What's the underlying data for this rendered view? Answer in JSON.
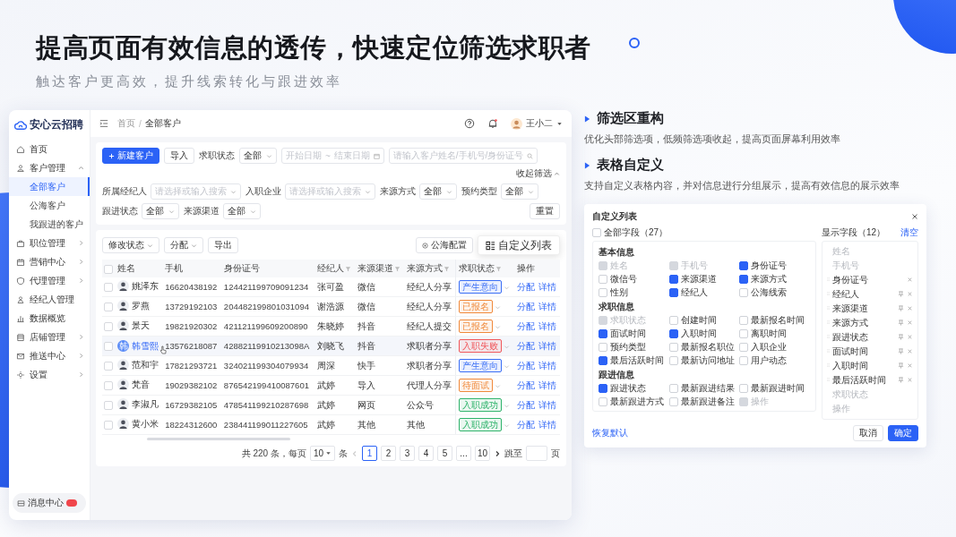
{
  "headline": "提高页面有效信息的透传，快速定位筛选求职者",
  "subheadline": "触达客户更高效，提升线索转化与跟进效率",
  "app": {
    "logo": "安心云招聘",
    "sidebar": {
      "items": [
        {
          "label": "首页",
          "has_children": false
        },
        {
          "label": "客户管理",
          "has_children": true,
          "expanded": true,
          "children": [
            {
              "label": "全部客户",
              "selected": true
            },
            {
              "label": "公海客户",
              "selected": false
            },
            {
              "label": "我跟进的客户",
              "selected": false
            }
          ]
        },
        {
          "label": "职位管理",
          "has_children": true,
          "expanded": false
        },
        {
          "label": "营销中心",
          "has_children": true,
          "expanded": false
        },
        {
          "label": "代理管理",
          "has_children": true,
          "expanded": false
        },
        {
          "label": "经纪人管理",
          "has_children": false
        },
        {
          "label": "数据概览",
          "has_children": false
        },
        {
          "label": "店铺管理",
          "has_children": true,
          "expanded": false
        },
        {
          "label": "推送中心",
          "has_children": true,
          "expanded": false
        },
        {
          "label": "设置",
          "has_children": true,
          "expanded": false
        }
      ],
      "message_center": "消息中心"
    },
    "header": {
      "breadcrumb": [
        "首页",
        "全部客户"
      ],
      "breadcrumb_separator": "/",
      "user": "王小二"
    },
    "filters": {
      "buttons": [
        {
          "label": "新建客户",
          "kind": "primary"
        },
        {
          "label": "导入",
          "kind": "default"
        }
      ],
      "row_1": [
        {
          "kind": "select",
          "label": "求职状态",
          "value": "全部"
        },
        {
          "kind": "date_range",
          "start_placeholder": "开始日期",
          "separator": "~",
          "end_placeholder": "结束日期"
        },
        {
          "kind": "search",
          "placeholder": "请输入客户姓名/手机号/身份证号"
        }
      ],
      "collapse": "收起筛选",
      "row_2": [
        {
          "kind": "select",
          "label": "所属经纪人",
          "placeholder": "请选择或输入搜索"
        },
        {
          "kind": "select",
          "label": "入职企业",
          "placeholder": "请选择或输入搜索"
        },
        {
          "kind": "select",
          "label": "来源方式",
          "value": "全部"
        },
        {
          "kind": "select",
          "label": "预约类型",
          "value": "全部"
        },
        {
          "kind": "select",
          "label": "跟进状态",
          "value": "全部"
        },
        {
          "kind": "select",
          "label": "来源渠道",
          "value": "全部"
        }
      ],
      "reset": "重置"
    },
    "toolbar": {
      "buttons": [
        {
          "label": "修改状态",
          "dropdown": true
        },
        {
          "label": "分配",
          "dropdown": true
        },
        {
          "label": "导出",
          "dropdown": false
        }
      ],
      "pool_config": "公海配置",
      "custom_columns": "自定义列表"
    },
    "table": {
      "select_all": {
        "checked": false
      },
      "columns": [
        {
          "label": "姓名",
          "filter": false
        },
        {
          "label": "手机",
          "filter": false
        },
        {
          "label": "身份证号",
          "filter": false
        },
        {
          "label": "经纪人",
          "filter": true
        },
        {
          "label": "来源渠道",
          "filter": true
        },
        {
          "label": "来源方式",
          "filter": true
        },
        {
          "label": "求职状态",
          "filter": true
        },
        {
          "label": "操作",
          "filter": false
        }
      ],
      "rows": [
        {
          "avatar": {
            "kind": "photo"
          },
          "name": "姚泽东",
          "phone": "16620438192",
          "id_number": "124421199709091234",
          "agent": "张可盈",
          "channel": "微信",
          "method": "经纪人分享",
          "status": {
            "text": "产生意向",
            "color": "#3b6ff5"
          },
          "actions": [
            "分配",
            "详情"
          ],
          "highlighted": false,
          "checked": false
        },
        {
          "avatar": {
            "kind": "photo"
          },
          "name": "罗燕",
          "phone": "13729192103",
          "id_number": "204482199801031094",
          "agent": "谢浩源",
          "channel": "微信",
          "method": "经纪人分享",
          "status": {
            "text": "已报名",
            "color": "#f08a3c"
          },
          "actions": [
            "分配",
            "详情"
          ],
          "highlighted": false,
          "checked": false
        },
        {
          "avatar": {
            "kind": "photo"
          },
          "name": "景天",
          "phone": "19821920302",
          "id_number": "421121199609200890",
          "agent": "朱晓婷",
          "channel": "抖音",
          "method": "经纪人提交",
          "status": {
            "text": "已报名",
            "color": "#f08a3c"
          },
          "actions": [
            "分配",
            "详情"
          ],
          "highlighted": false,
          "checked": false
        },
        {
          "avatar": {
            "kind": "letter",
            "text": "韩"
          },
          "name": "韩雪熙",
          "phone": "13576218087",
          "id_number": "42882119910213098A",
          "agent": "刘晓飞",
          "channel": "抖音",
          "method": "求职者分享",
          "status": {
            "text": "入职失败",
            "color": "#f0575b"
          },
          "actions": [
            "分配",
            "详情"
          ],
          "highlighted": true,
          "checked": false
        },
        {
          "avatar": {
            "kind": "photo"
          },
          "name": "范和宇",
          "phone": "17821293721",
          "id_number": "324021199304079934",
          "agent": "周深",
          "channel": "快手",
          "method": "求职者分享",
          "status": {
            "text": "产生意向",
            "color": "#3b6ff5"
          },
          "actions": [
            "分配",
            "详情"
          ],
          "highlighted": false,
          "checked": false
        },
        {
          "avatar": {
            "kind": "photo"
          },
          "name": "梵音",
          "phone": "19029382102",
          "id_number": "876542199410087601",
          "agent": "武婷",
          "channel": "导入",
          "method": "代理人分享",
          "status": {
            "text": "待面试",
            "color": "#f08a3c"
          },
          "actions": [
            "分配",
            "详情"
          ],
          "highlighted": false,
          "checked": false
        },
        {
          "avatar": {
            "kind": "photo"
          },
          "name": "李淑凡",
          "phone": "16729382105",
          "id_number": "478541199210287698",
          "agent": "武婷",
          "channel": "网页",
          "method": "公众号",
          "status": {
            "text": "入职成功",
            "color": "#2fb36b"
          },
          "actions": [
            "分配",
            "详情"
          ],
          "highlighted": false,
          "checked": false
        },
        {
          "avatar": {
            "kind": "photo"
          },
          "name": "黄小米",
          "phone": "18224312600",
          "id_number": "238441199011227605",
          "agent": "武婷",
          "channel": "其他",
          "method": "其他",
          "status": {
            "text": "入职成功",
            "color": "#2fb36b"
          },
          "actions": [
            "分配",
            "详情"
          ],
          "highlighted": false,
          "checked": false
        }
      ]
    },
    "pagination": {
      "total": "共 220 条，每页",
      "page_size": "10",
      "unit": "条",
      "pages": [
        {
          "label": "1",
          "selected": true
        },
        {
          "label": "2",
          "selected": false
        },
        {
          "label": "3",
          "selected": false
        },
        {
          "label": "4",
          "selected": false
        },
        {
          "label": "5",
          "selected": false
        },
        {
          "label": "...",
          "selected": false
        },
        {
          "label": "10",
          "selected": false
        }
      ],
      "jump": "跳至",
      "page_unit": "页"
    }
  },
  "features": [
    {
      "title": "筛选区重构",
      "description": "优化头部筛选项，低频筛选项收起，提高页面屏幕利用效率"
    },
    {
      "title": "表格自定义",
      "description": "支持自定义表格内容，并对信息进行分组展示，提高有效信息的展示效率"
    }
  ],
  "dialog": {
    "title": "自定义列表",
    "all_fields": {
      "label": "全部字段（27）",
      "checked": false
    },
    "shown_label": "显示字段（12）",
    "clear": "清空",
    "groups": [
      {
        "title": "基本信息",
        "fields": [
          {
            "label": "姓名",
            "checked": true,
            "disabled": true
          },
          {
            "label": "手机号",
            "checked": true,
            "disabled": true
          },
          {
            "label": "身份证号",
            "checked": true,
            "disabled": false
          },
          {
            "label": "微信号",
            "checked": false,
            "disabled": false
          },
          {
            "label": "来源渠道",
            "checked": true,
            "disabled": false
          },
          {
            "label": "来源方式",
            "checked": true,
            "disabled": false
          },
          {
            "label": "性别",
            "checked": false,
            "disabled": false
          },
          {
            "label": "经纪人",
            "checked": true,
            "disabled": false
          },
          {
            "label": "公海线索",
            "checked": false,
            "disabled": false
          }
        ]
      },
      {
        "title": "求职信息",
        "fields": [
          {
            "label": "求职状态",
            "checked": true,
            "disabled": true
          },
          {
            "label": "创建时间",
            "checked": false,
            "disabled": false
          },
          {
            "label": "最新报名时间",
            "checked": false,
            "disabled": false
          },
          {
            "label": "面试时间",
            "checked": true,
            "disabled": false
          },
          {
            "label": "入职时间",
            "checked": true,
            "disabled": false
          },
          {
            "label": "离职时间",
            "checked": false,
            "disabled": false
          },
          {
            "label": "预约类型",
            "checked": false,
            "disabled": false
          },
          {
            "label": "最新报名职位",
            "checked": false,
            "disabled": false
          },
          {
            "label": "入职企业",
            "checked": false,
            "disabled": false
          },
          {
            "label": "最后活跃时间",
            "checked": true,
            "disabled": false
          },
          {
            "label": "最新访问地址",
            "checked": false,
            "disabled": false
          },
          {
            "label": "用户动态",
            "checked": false,
            "disabled": false
          }
        ]
      },
      {
        "title": "跟进信息",
        "fields": [
          {
            "label": "跟进状态",
            "checked": true,
            "disabled": false
          },
          {
            "label": "最新跟进结果",
            "checked": false,
            "disabled": false
          },
          {
            "label": "最新跟进时间",
            "checked": false,
            "disabled": false
          },
          {
            "label": "最新跟进方式",
            "checked": false,
            "disabled": false
          },
          {
            "label": "最新跟进备注",
            "checked": false,
            "disabled": false
          },
          {
            "label": "操作",
            "checked": true,
            "disabled": true
          }
        ]
      }
    ],
    "shown": [
      {
        "label": "姓名",
        "kind": "fixed"
      },
      {
        "label": "手机号",
        "kind": "fixed"
      },
      {
        "label": "身份证号",
        "kind": "movable",
        "pinnable": false
      },
      {
        "label": "经纪人",
        "kind": "movable",
        "pinnable": true
      },
      {
        "label": "来源渠道",
        "kind": "movable",
        "pinnable": true
      },
      {
        "label": "来源方式",
        "kind": "movable",
        "pinnable": true
      },
      {
        "label": "跟进状态",
        "kind": "movable",
        "pinnable": true
      },
      {
        "label": "面试时间",
        "kind": "movable",
        "pinnable": true
      },
      {
        "label": "入职时间",
        "kind": "movable",
        "pinnable": true
      },
      {
        "label": "最后活跃时间",
        "kind": "movable",
        "pinnable": true
      },
      {
        "label": "求职状态",
        "kind": "fixed"
      },
      {
        "label": "操作",
        "kind": "fixed"
      }
    ],
    "restore": "恢复默认",
    "cancel": "取消",
    "confirm": "确定"
  }
}
